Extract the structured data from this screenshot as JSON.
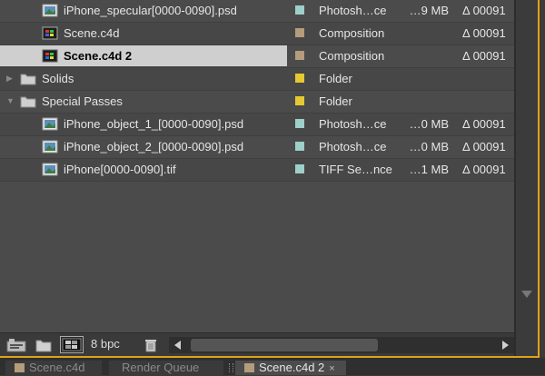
{
  "colors": {
    "accent": "#e0a21a",
    "label_teal": "#9ecfc8",
    "label_tan": "#b49c7c",
    "label_yellow": "#e6c833"
  },
  "rows": [
    {
      "name": "iPhone_specular[0000-0090].psd",
      "type": "Photosh…ce",
      "size": "…9 MB",
      "date": "Δ 00091",
      "icon": "image-footage-icon",
      "label": "#9ecfc8"
    },
    {
      "name": "Scene.c4d",
      "type": "Composition",
      "size": "",
      "date": "Δ 00091",
      "icon": "composition-icon",
      "label": "#b49c7c"
    },
    {
      "name": "Scene.c4d 2",
      "type": "Composition",
      "size": "",
      "date": "Δ 00091",
      "icon": "composition-icon",
      "label": "#b49c7c"
    },
    {
      "name": "Solids",
      "type": "Folder",
      "size": "",
      "date": "",
      "icon": "folder-icon",
      "label": "#e6c833"
    },
    {
      "name": "Special Passes",
      "type": "Folder",
      "size": "",
      "date": "",
      "icon": "folder-icon",
      "label": "#e6c833"
    },
    {
      "name": "iPhone_object_1_[0000-0090].psd",
      "type": "Photosh…ce",
      "size": "…0 MB",
      "date": "Δ 00091",
      "icon": "image-footage-icon",
      "label": "#9ecfc8"
    },
    {
      "name": "iPhone_object_2_[0000-0090].psd",
      "type": "Photosh…ce",
      "size": "…0 MB",
      "date": "Δ 00091",
      "icon": "image-footage-icon",
      "label": "#9ecfc8"
    },
    {
      "name": "iPhone[0000-0090].tif",
      "type": "TIFF Se…nce",
      "size": "…1 MB",
      "date": "Δ 00091",
      "icon": "image-footage-icon",
      "label": "#9ecfc8"
    }
  ],
  "bottom": {
    "bpc_label": "8 bpc"
  },
  "tabs": [
    {
      "label": "Scene.c4d"
    },
    {
      "label": "Render Queue"
    },
    {
      "label": "Scene.c4d 2",
      "close": "×"
    }
  ]
}
